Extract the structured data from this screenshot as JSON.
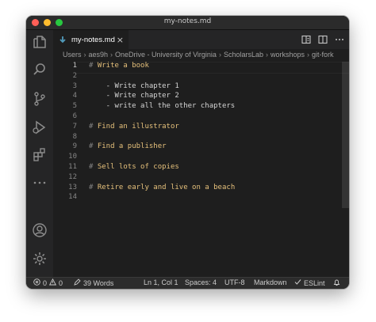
{
  "window": {
    "title": "my-notes.md"
  },
  "activity_bar": [
    {
      "name": "explorer-icon"
    },
    {
      "name": "search-icon"
    },
    {
      "name": "source-control-icon"
    },
    {
      "name": "run-debug-icon"
    },
    {
      "name": "extensions-icon"
    },
    {
      "name": "more-icon"
    },
    {
      "name": "account-icon"
    },
    {
      "name": "settings-gear-icon"
    }
  ],
  "tab": {
    "label": "my-notes.md",
    "close": "×"
  },
  "breadcrumb": [
    "Users",
    "aes9h",
    "OneDrive - University of Virginia",
    "ScholarsLab",
    "workshops",
    "git-fork"
  ],
  "editor": {
    "active_line": 1,
    "lines": [
      {
        "num": "1",
        "hash": "#",
        "text": " Write a book"
      },
      {
        "num": "2",
        "hash": "",
        "text": ""
      },
      {
        "num": "3",
        "hash": "",
        "text": "    - Write chapter 1"
      },
      {
        "num": "4",
        "hash": "",
        "text": "    - Write chapter 2"
      },
      {
        "num": "5",
        "hash": "",
        "text": "    - write all the other chapters"
      },
      {
        "num": "6",
        "hash": "",
        "text": ""
      },
      {
        "num": "7",
        "hash": "#",
        "text": " Find an illustrator"
      },
      {
        "num": "8",
        "hash": "",
        "text": ""
      },
      {
        "num": "9",
        "hash": "#",
        "text": " Find a publisher"
      },
      {
        "num": "10",
        "hash": "",
        "text": ""
      },
      {
        "num": "11",
        "hash": "#",
        "text": " Sell lots of copies"
      },
      {
        "num": "12",
        "hash": "",
        "text": ""
      },
      {
        "num": "13",
        "hash": "#",
        "text": " Retire early and live on a beach"
      },
      {
        "num": "14",
        "hash": "",
        "text": ""
      }
    ]
  },
  "status_bar": {
    "errors": "0",
    "warnings": "0",
    "word_count": "39 Words",
    "position": "Ln 1, Col 1",
    "spaces": "Spaces: 4",
    "encoding": "UTF-8",
    "language": "Markdown",
    "eslint": "ESLint"
  },
  "colors": {
    "accent_heading": "#e5c07b",
    "tab_icon": "#519aba"
  }
}
